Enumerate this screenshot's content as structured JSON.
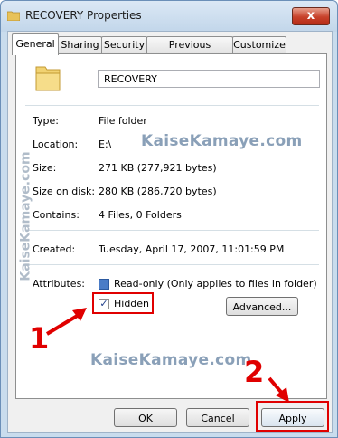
{
  "window": {
    "title": "RECOVERY Properties",
    "close_glyph": "x"
  },
  "tabs": [
    {
      "label": "General",
      "active": true
    },
    {
      "label": "Sharing"
    },
    {
      "label": "Security"
    },
    {
      "label": "Previous Versions"
    },
    {
      "label": "Customize"
    }
  ],
  "general": {
    "name_value": "RECOVERY",
    "rows": [
      {
        "label": "Type:",
        "value": "File folder"
      },
      {
        "label": "Location:",
        "value": "E:\\"
      },
      {
        "label": "Size:",
        "value": "271 KB (277,921 bytes)"
      },
      {
        "label": "Size on disk:",
        "value": "280 KB (286,720 bytes)"
      },
      {
        "label": "Contains:",
        "value": "4 Files, 0 Folders"
      },
      {
        "label": "Created:",
        "value": "Tuesday, April 17, 2007, 11:01:59 PM"
      }
    ],
    "attributes_label": "Attributes:",
    "readonly_label": "Read-only (Only applies to files in folder)",
    "hidden_label": "Hidden",
    "hidden_checked": true,
    "advanced_label": "Advanced..."
  },
  "buttons": {
    "ok": "OK",
    "cancel": "Cancel",
    "apply": "Apply"
  },
  "watermark": "KaiseKamaye.com",
  "annotations": {
    "step1": "1",
    "step2": "2"
  },
  "colors": {
    "annotation": "#e00000",
    "titlebar": "#c9dced"
  }
}
